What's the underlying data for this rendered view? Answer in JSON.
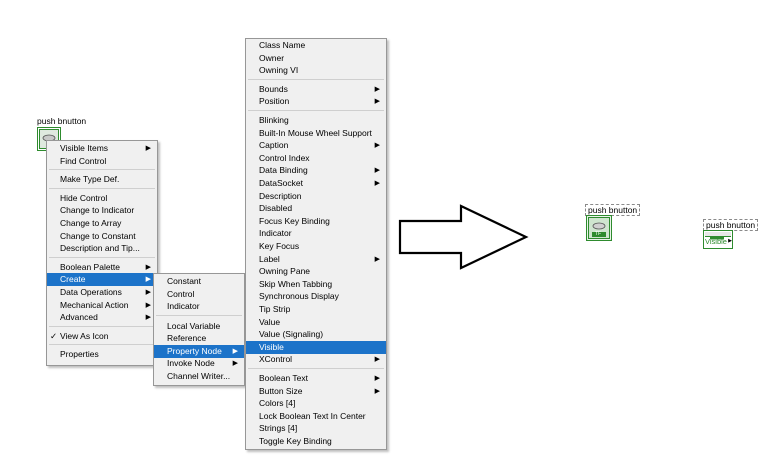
{
  "left_control": {
    "label": "push bnutton",
    "context_menu": {
      "items": [
        {
          "label": "Visible Items",
          "submenu": true
        },
        {
          "label": "Find Control"
        },
        {
          "sep": true
        },
        {
          "label": "Make Type Def."
        },
        {
          "sep": true
        },
        {
          "label": "Hide Control"
        },
        {
          "label": "Change to Indicator"
        },
        {
          "label": "Change to Array"
        },
        {
          "label": "Change to Constant"
        },
        {
          "label": "Description and Tip..."
        },
        {
          "sep": true
        },
        {
          "label": "Boolean Palette",
          "submenu": true
        },
        {
          "label": "Create",
          "submenu": true,
          "selected": true
        },
        {
          "label": "Data Operations",
          "submenu": true
        },
        {
          "label": "Mechanical Action",
          "submenu": true
        },
        {
          "label": "Advanced",
          "submenu": true
        },
        {
          "sep": true
        },
        {
          "label": "View As Icon",
          "checked": true
        },
        {
          "sep": true
        },
        {
          "label": "Properties"
        }
      ]
    },
    "create_menu": {
      "items": [
        {
          "label": "Constant"
        },
        {
          "label": "Control"
        },
        {
          "label": "Indicator"
        },
        {
          "sep": true
        },
        {
          "label": "Local Variable"
        },
        {
          "label": "Reference"
        },
        {
          "label": "Property Node",
          "submenu": true,
          "selected": true
        },
        {
          "label": "Invoke Node",
          "submenu": true
        },
        {
          "label": "Channel Writer..."
        }
      ]
    },
    "property_menu": {
      "items": [
        {
          "label": "Class Name"
        },
        {
          "label": "Owner"
        },
        {
          "label": "Owning VI"
        },
        {
          "sep": true
        },
        {
          "label": "Bounds",
          "submenu": true
        },
        {
          "label": "Position",
          "submenu": true
        },
        {
          "sep": true
        },
        {
          "label": "Blinking"
        },
        {
          "label": "Built-In Mouse Wheel Support"
        },
        {
          "label": "Caption",
          "submenu": true
        },
        {
          "label": "Control Index"
        },
        {
          "label": "Data Binding",
          "submenu": true
        },
        {
          "label": "DataSocket",
          "submenu": true
        },
        {
          "label": "Description"
        },
        {
          "label": "Disabled"
        },
        {
          "label": "Focus Key Binding"
        },
        {
          "label": "Indicator"
        },
        {
          "label": "Key Focus"
        },
        {
          "label": "Label",
          "submenu": true
        },
        {
          "label": "Owning Pane"
        },
        {
          "label": "Skip When Tabbing"
        },
        {
          "label": "Synchronous Display"
        },
        {
          "label": "Tip Strip"
        },
        {
          "label": "Value"
        },
        {
          "label": "Value (Signaling)"
        },
        {
          "label": "Visible",
          "selected": true
        },
        {
          "label": "XControl",
          "submenu": true
        },
        {
          "sep": true
        },
        {
          "label": "Boolean Text",
          "submenu": true
        },
        {
          "label": "Button Size",
          "submenu": true
        },
        {
          "label": "Colors [4]"
        },
        {
          "label": "Lock Boolean Text In Center"
        },
        {
          "label": "Strings [4]"
        },
        {
          "label": "Toggle Key Binding"
        }
      ]
    }
  },
  "right_control": {
    "label": "push bnutton",
    "icon_text": "TF"
  },
  "property_node": {
    "label": "push bnutton",
    "property": "Visible"
  },
  "colors": {
    "accent": "#1c73c9",
    "terminal_green": "#2e8b2e"
  },
  "icons": {
    "arrow": "right-arrow-outline",
    "submenu": "triangle-right",
    "check": "check-mark"
  }
}
